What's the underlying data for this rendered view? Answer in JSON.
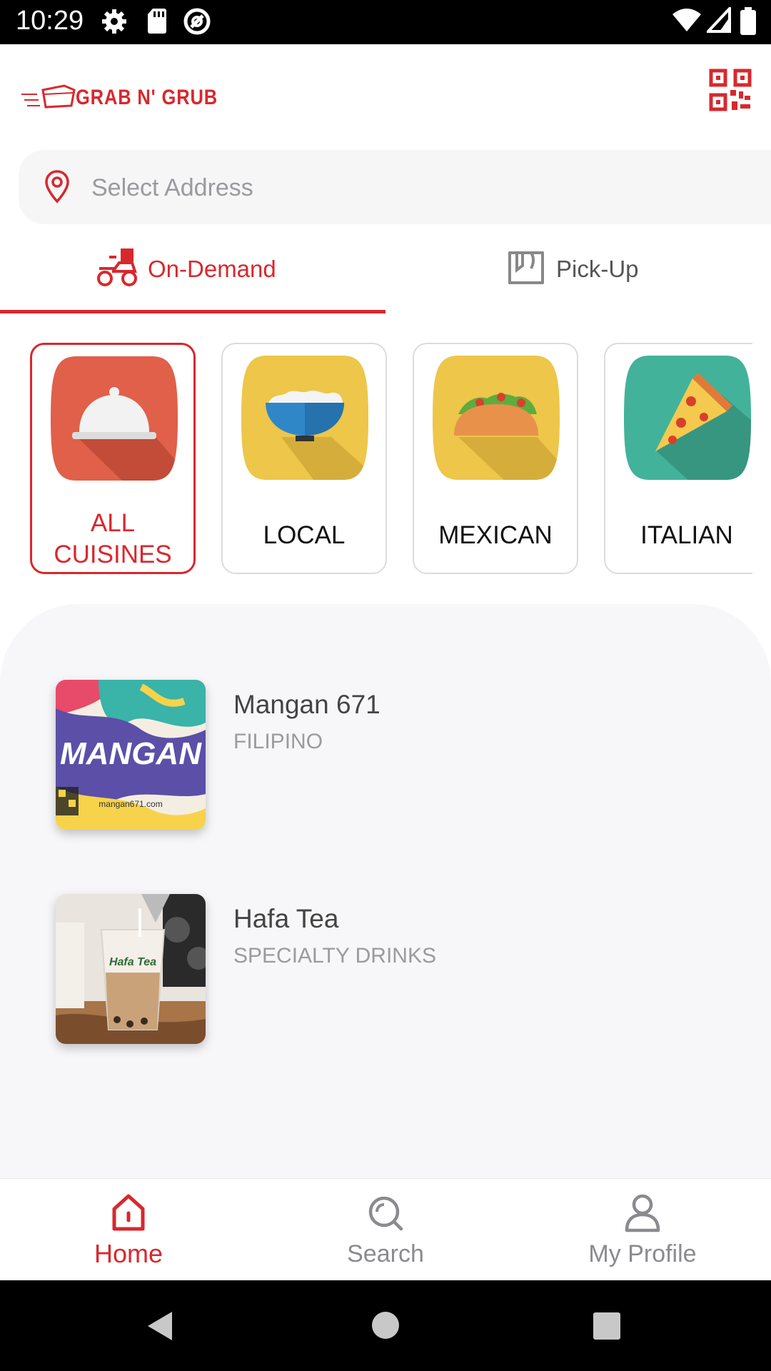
{
  "status_bar": {
    "time": "10:29",
    "icons": [
      "settings-icon",
      "sd-card-icon",
      "sync-icon",
      "wifi-icon",
      "signal-icon",
      "battery-icon"
    ]
  },
  "header": {
    "logo_text": "GRAB N' GRUB",
    "qr_button": "qr-code-icon"
  },
  "address": {
    "placeholder": "Select Address"
  },
  "tabs": [
    {
      "label": "On-Demand",
      "active": true
    },
    {
      "label": "Pick-Up",
      "active": false
    }
  ],
  "cuisines": [
    {
      "label": "ALL CUISINES",
      "label_line1": "ALL",
      "label_line2": "CUISINES",
      "selected": true,
      "icon": "cloche-icon",
      "color": "#e0604a"
    },
    {
      "label": "LOCAL",
      "selected": false,
      "icon": "rice-bowl-icon",
      "color": "#edc64a"
    },
    {
      "label": "MEXICAN",
      "selected": false,
      "icon": "taco-icon",
      "color": "#edc64a"
    },
    {
      "label": "ITALIAN",
      "selected": false,
      "icon": "pizza-icon",
      "color": "#43b29a"
    }
  ],
  "restaurants": [
    {
      "name": "Mangan 671",
      "category": "FILIPINO",
      "thumb_text": "MANGAN",
      "thumb_sub": "mangan671.com"
    },
    {
      "name": "Hafa Tea",
      "category": "SPECIALTY DRINKS",
      "thumb_text": "Hafa Tea"
    }
  ],
  "bottom_nav": [
    {
      "label": "Home",
      "icon": "home-icon",
      "active": true
    },
    {
      "label": "Search",
      "icon": "search-icon",
      "active": false
    },
    {
      "label": "My Profile",
      "icon": "profile-icon",
      "active": false
    }
  ],
  "colors": {
    "accent": "#d8282d",
    "list_bg": "#f7f7f9",
    "muted": "#9a9aa0"
  }
}
